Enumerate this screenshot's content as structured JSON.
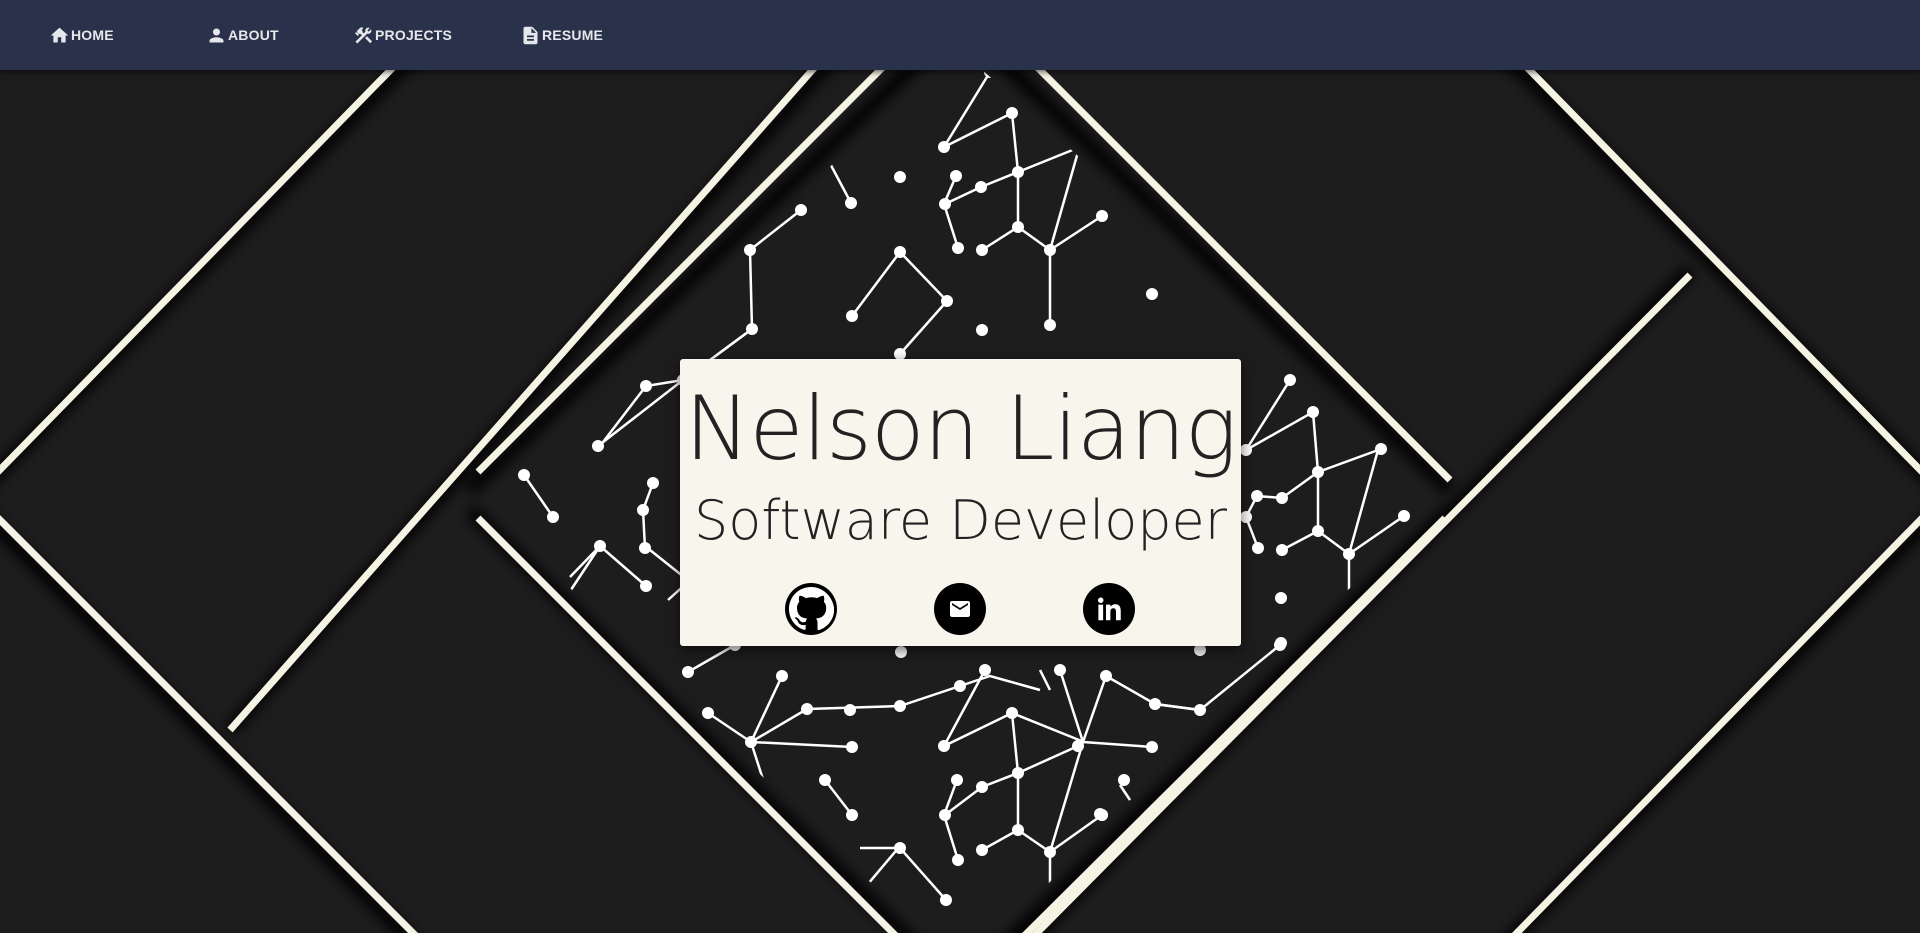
{
  "nav": {
    "items": [
      {
        "label": "HOME",
        "icon": "home-icon"
      },
      {
        "label": "ABOUT",
        "icon": "person-icon"
      },
      {
        "label": "PROJECTS",
        "icon": "tools-icon"
      },
      {
        "label": "RESUME",
        "icon": "document-icon"
      }
    ]
  },
  "hero": {
    "name": "Nelson Liang",
    "title": "Software Developer",
    "social": [
      {
        "icon": "github-icon"
      },
      {
        "icon": "email-icon"
      },
      {
        "icon": "linkedin-icon"
      }
    ]
  },
  "colors": {
    "navbar": "#29324a",
    "background": "#1e1d1e",
    "card": "#f8f6ec",
    "stripe": "#f5f3e4"
  }
}
